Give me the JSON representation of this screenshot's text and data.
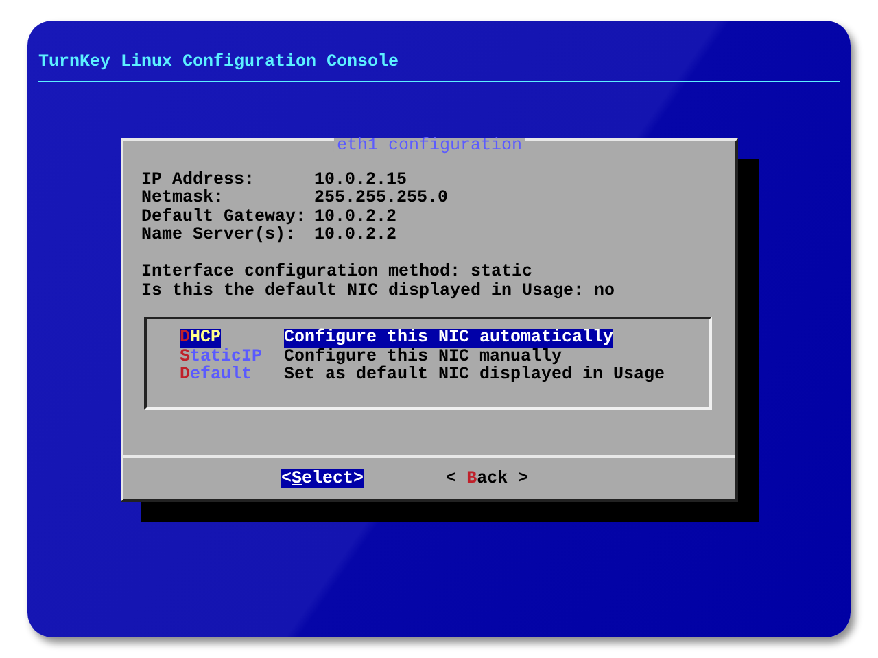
{
  "console_title": "TurnKey Linux Configuration Console",
  "dialog": {
    "title": "eth1 configuration",
    "fields": [
      {
        "label": "IP Address:",
        "value": "10.0.2.15"
      },
      {
        "label": "Netmask:",
        "value": "255.255.255.0"
      },
      {
        "label": "Default Gateway:",
        "value": "10.0.2.2"
      },
      {
        "label": "Name Server(s):",
        "value": "10.0.2.2"
      }
    ],
    "notes": [
      "Interface configuration method: static",
      "Is this the default NIC displayed in Usage: no"
    ],
    "menu": [
      {
        "tag": "DHCP",
        "description": "Configure this NIC automatically",
        "selected": true
      },
      {
        "tag": "StaticIP",
        "description": "Configure this NIC manually",
        "selected": false
      },
      {
        "tag": "Default",
        "description": "Set as default NIC displayed in Usage",
        "selected": false
      }
    ],
    "buttons": [
      {
        "label": "<Select>",
        "selected": true
      },
      {
        "label": "< Back >",
        "selected": false
      }
    ]
  }
}
